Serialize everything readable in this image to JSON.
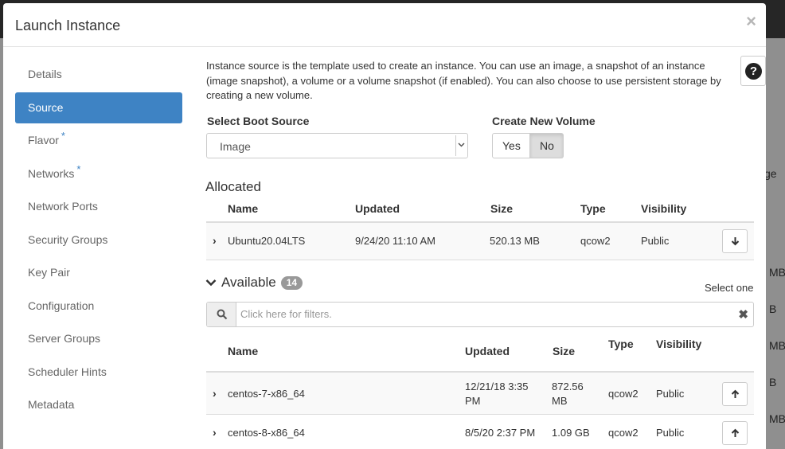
{
  "background": {
    "fragments": [
      "ge",
      "MB",
      "B",
      "MB",
      "B",
      "MB"
    ]
  },
  "modal": {
    "title": "Launch Instance",
    "close_label": "×"
  },
  "nav": {
    "items": [
      {
        "label": "Details",
        "required": false,
        "active": false
      },
      {
        "label": "Source",
        "required": false,
        "active": true
      },
      {
        "label": "Flavor",
        "required": true,
        "active": false
      },
      {
        "label": "Networks",
        "required": true,
        "active": false
      },
      {
        "label": "Network Ports",
        "required": false,
        "active": false
      },
      {
        "label": "Security Groups",
        "required": false,
        "active": false
      },
      {
        "label": "Key Pair",
        "required": false,
        "active": false
      },
      {
        "label": "Configuration",
        "required": false,
        "active": false
      },
      {
        "label": "Server Groups",
        "required": false,
        "active": false
      },
      {
        "label": "Scheduler Hints",
        "required": false,
        "active": false
      },
      {
        "label": "Metadata",
        "required": false,
        "active": false
      }
    ],
    "required_marker": "*"
  },
  "source": {
    "help_text": "Instance source is the template used to create an instance. You can use an image, a snapshot of an instance (image snapshot), a volume or a volume snapshot (if enabled). You can also choose to use persistent storage by creating a new volume.",
    "help_icon": "?",
    "boot_source_label": "Select Boot Source",
    "boot_source_value": "Image",
    "create_volume_label": "Create New Volume",
    "volume_yes": "Yes",
    "volume_no": "No",
    "volume_selected": "No"
  },
  "allocated": {
    "title": "Allocated",
    "columns": [
      "Name",
      "Updated",
      "Size",
      "Type",
      "Visibility"
    ],
    "rows": [
      {
        "name": "Ubuntu20.04LTS",
        "updated": "9/24/20 11:10 AM",
        "size": "520.13 MB",
        "type": "qcow2",
        "visibility": "Public"
      }
    ]
  },
  "available": {
    "title": "Available",
    "count": "14",
    "select_hint": "Select one",
    "filter_placeholder": "Click here for filters.",
    "filter_clear": "✖",
    "columns": [
      "Name",
      "Updated",
      "Size",
      "Type",
      "Visibility"
    ],
    "rows": [
      {
        "name": "centos-7-x86_64",
        "updated_line1": "12/21/18 3:35",
        "updated_line2": "PM",
        "size_line1": "872.56",
        "size_line2": "MB",
        "type": "qcow2",
        "visibility": "Public"
      },
      {
        "name": "centos-8-x86_64",
        "updated_line1": "8/5/20 2:37 PM",
        "updated_line2": "",
        "size_line1": "1.09 GB",
        "size_line2": "",
        "type": "qcow2",
        "visibility": "Public"
      }
    ]
  }
}
